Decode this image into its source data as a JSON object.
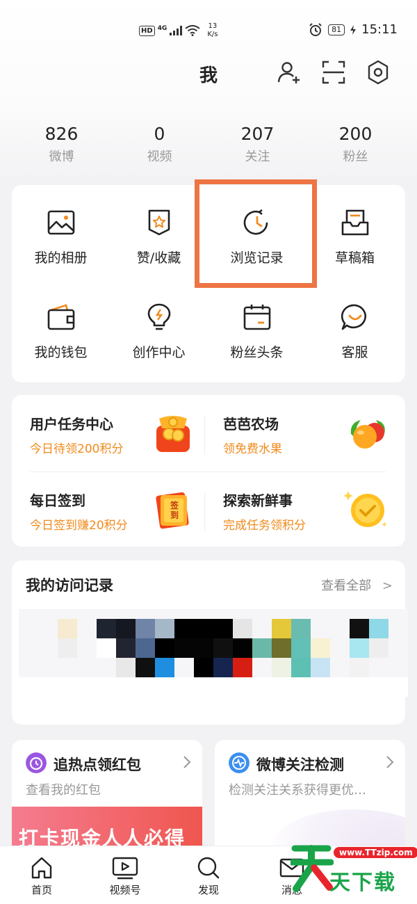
{
  "status_bar": {
    "hd": "HD",
    "network": "4G",
    "speed_value": "13",
    "speed_unit": "K/s",
    "battery": "81",
    "time": "15:11"
  },
  "header": {
    "title": "我",
    "icons": [
      "add-user-icon",
      "scan-icon",
      "settings-icon"
    ]
  },
  "stats": [
    {
      "value": "826",
      "label": "微博"
    },
    {
      "value": "0",
      "label": "视频"
    },
    {
      "value": "207",
      "label": "关注"
    },
    {
      "value": "200",
      "label": "粉丝"
    }
  ],
  "grid": [
    {
      "label": "我的相册",
      "icon": "album-icon"
    },
    {
      "label": "赞/收藏",
      "icon": "favorites-icon"
    },
    {
      "label": "浏览记录",
      "icon": "history-icon"
    },
    {
      "label": "草稿箱",
      "icon": "drafts-icon"
    },
    {
      "label": "我的钱包",
      "icon": "wallet-icon"
    },
    {
      "label": "创作中心",
      "icon": "creator-bulb-icon"
    },
    {
      "label": "粉丝头条",
      "icon": "calendar-icon"
    },
    {
      "label": "客服",
      "icon": "customer-service-icon"
    }
  ],
  "tasks": [
    {
      "title": "用户任务中心",
      "sub": "今日待领200积分"
    },
    {
      "title": "芭芭农场",
      "sub": "领免费水果"
    },
    {
      "title": "每日签到",
      "sub": "今日签到赚20积分",
      "badge": "签到"
    },
    {
      "title": "探索新鲜事",
      "sub": "完成任务领积分"
    }
  ],
  "visits": {
    "title": "我的访问记录",
    "view_all": "查看全部"
  },
  "promos": [
    {
      "title": "追热点领红包",
      "sub": "查看我的红包",
      "banner": "打卡现金人人必得"
    },
    {
      "title": "微博关注检测",
      "sub": "检测关注关系获得更优…"
    }
  ],
  "tabbar": [
    {
      "label": "首页",
      "icon": "home-icon"
    },
    {
      "label": "视频号",
      "icon": "video-icon"
    },
    {
      "label": "发现",
      "icon": "discover-icon"
    },
    {
      "label": "消息",
      "icon": "message-icon"
    }
  ],
  "watermark": {
    "url": "www.TTzip.com",
    "text": "天下载"
  },
  "colors": {
    "accent_orange": "#f08a1c",
    "highlight": "#ee7444",
    "text_dark": "#222222",
    "text_gray": "#999999"
  }
}
